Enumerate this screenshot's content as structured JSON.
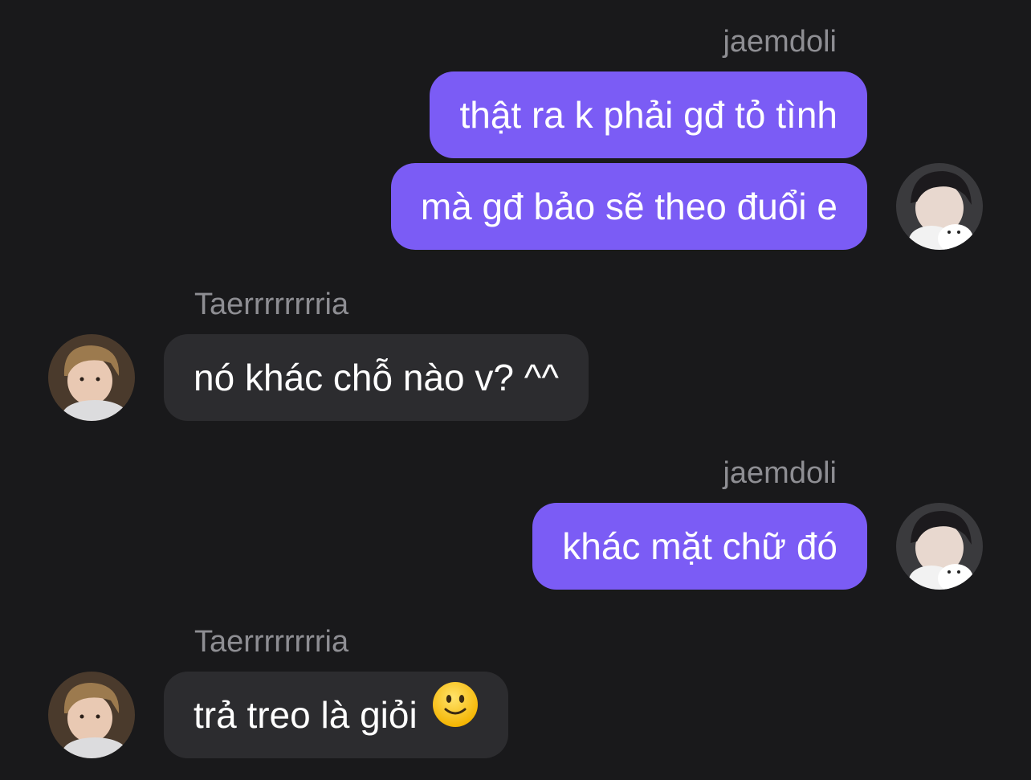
{
  "participants": {
    "me": "jaemdoli",
    "other": "Taerrrrrrrria"
  },
  "messages": [
    {
      "sender": "jaemdoli",
      "text": "thật ra k phải gđ tỏ tình"
    },
    {
      "sender": "jaemdoli",
      "text": "mà gđ bảo sẽ theo đuổi e"
    },
    {
      "sender": "Taerrrrrrrria",
      "text": "nó khác chỗ nào v? ^^"
    },
    {
      "sender": "jaemdoli",
      "text": "khác mặt chữ đó"
    },
    {
      "sender": "Taerrrrrrrria",
      "text": "trả treo là giỏi",
      "emoji": "slightly-smiling-face-icon"
    }
  ],
  "colors": {
    "background": "#19191b",
    "outgoing_bubble": "#7b5cf5",
    "incoming_bubble": "#2c2c2f",
    "sender_name": "#8e8e93",
    "text": "#ffffff"
  }
}
